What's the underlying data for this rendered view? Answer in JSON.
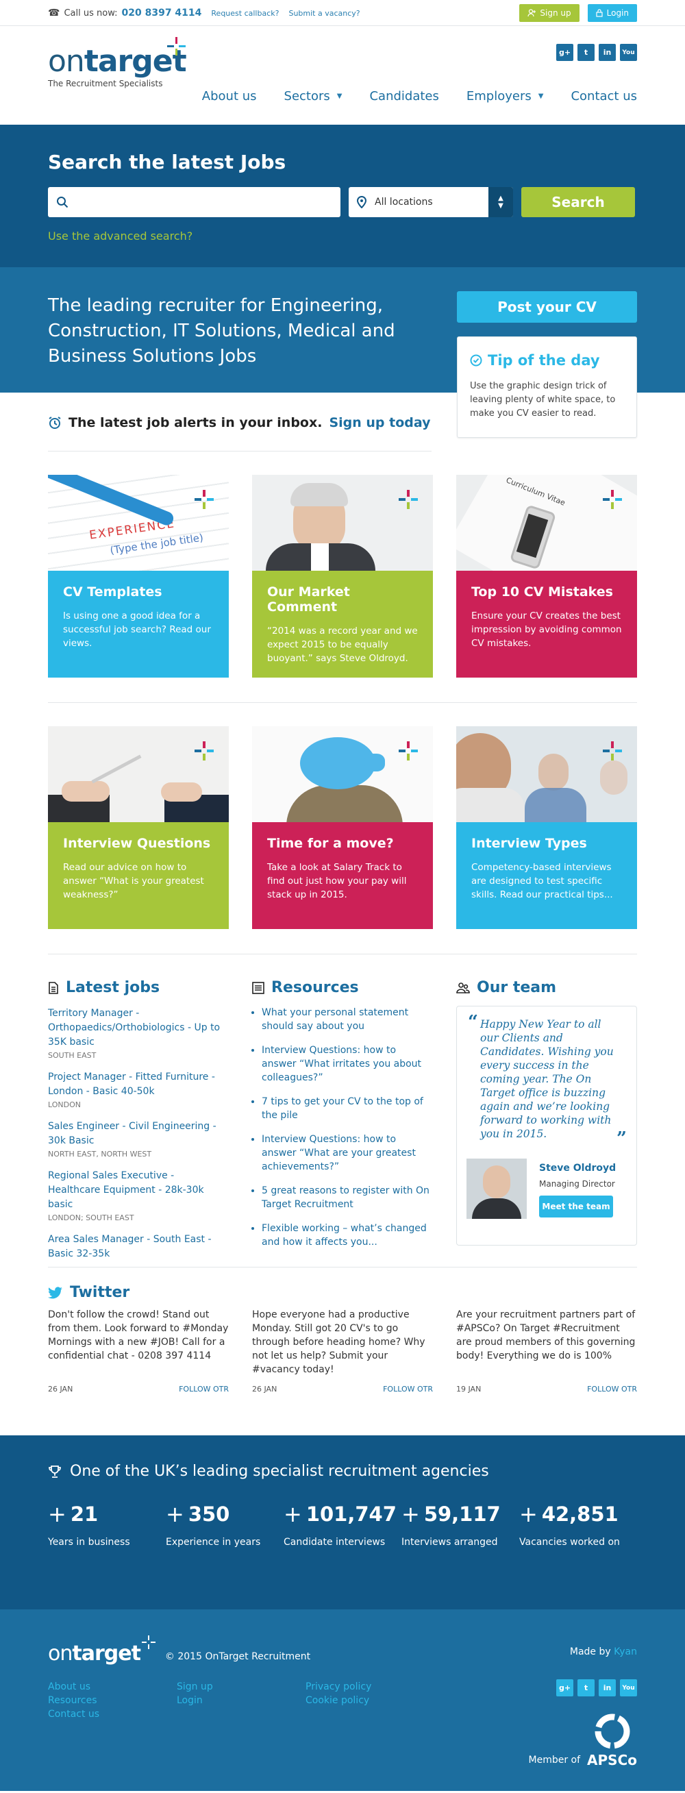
{
  "topbar": {
    "call_label": "Call us now:",
    "phone": "020 8397 4114",
    "callback": "Request callback?",
    "vacancy": "Submit a vacancy?",
    "signup": "Sign up",
    "login": "Login"
  },
  "logo": {
    "on": "on",
    "target": "target",
    "tagline": "The Recruitment Specialists"
  },
  "social": [
    "g+",
    "t",
    "in",
    "You"
  ],
  "nav": {
    "about": "About us",
    "sectors": "Sectors",
    "candidates": "Candidates",
    "employers": "Employers",
    "contact": "Contact us"
  },
  "search": {
    "title": "Search the latest Jobs",
    "keyword_placeholder": "",
    "location": "All locations",
    "button": "Search",
    "advanced": "Use the advanced search?"
  },
  "banner": {
    "headline": "The leading recruiter for Engineering, Construction, IT Solutions, Medical and Business Solutions Jobs",
    "post_cv": "Post your CV"
  },
  "tip": {
    "title": "Tip of the day",
    "text": "Use the graphic design trick of leaving plenty of white space, to make you CV easier to read."
  },
  "alerts": {
    "text": "The latest job alerts in your inbox.",
    "link": "Sign up today"
  },
  "cards": [
    {
      "title": "CV Templates",
      "text": "Is using one a good idea for a successful job search? Read our views."
    },
    {
      "title": "Our Market Comment",
      "text": "“2014 was a record year and we expect 2015 to be equally buoyant.” says Steve Oldroyd."
    },
    {
      "title": "Top 10 CV Mistakes",
      "text": "Ensure your CV creates the best impression by avoiding common CV mistakes."
    },
    {
      "title": "Interview Questions",
      "text": "Read our advice on how to answer “What is your greatest weakness?”"
    },
    {
      "title": "Time for a move?",
      "text": "Take a look at Salary Track to find out just how your pay will stack up in 2015."
    },
    {
      "title": "Interview Types",
      "text": "Competency-based interviews are designed to test specific skills. Read our practical tips..."
    }
  ],
  "card_images": {
    "cv_doc": "Curriculum Vitae",
    "experience": "EXPERIENCE",
    "paper_lines": "(Type the job title)"
  },
  "latest_jobs": {
    "title": "Latest jobs",
    "items": [
      {
        "title": "Territory Manager - Orthopaedics/Orthobiologics - Up to 35K basic",
        "loc": "SOUTH EAST"
      },
      {
        "title": "Project Manager - Fitted Furniture - London - Basic 40-50k",
        "loc": "LONDON"
      },
      {
        "title": "Sales Engineer - Civil Engineering - 30k Basic",
        "loc": "NORTH EAST, NORTH WEST"
      },
      {
        "title": "Regional Sales Executive - Healthcare Equipment - 28k-30k basic",
        "loc": "LONDON; SOUTH EAST"
      },
      {
        "title": "Area Sales Manager - South East - Basic 32-35k",
        "loc": ""
      }
    ]
  },
  "resources": {
    "title": "Resources",
    "items": [
      "What your personal statement should say about you",
      "Interview Questions: how to answer “What irritates you about colleagues?”",
      "7 tips to get your CV to the top of the pile",
      "Interview Questions: how to answer “What are your greatest achievements?”",
      "5 great reasons to register with On Target Recruitment",
      "Flexible working – what’s changed and how it affects you..."
    ]
  },
  "team": {
    "title": "Our team",
    "quote": "Happy New Year to all our Clients and Candidates. Wishing you every success in the coming year. The On Target office is buzzing again and we’re looking forward to working with you in 2015.",
    "name": "Steve Oldroyd",
    "role": "Managing Director",
    "button": "Meet the team"
  },
  "twitter": {
    "title": "Twitter",
    "tweets": [
      {
        "text": "Don't follow the crowd! Stand out from them. Look forward to #Monday Mornings with a new #JOB! Call for a confidential chat - 0208 397 4114",
        "date": "26 JAN",
        "follow": "FOLLOW OTR"
      },
      {
        "text": "Hope everyone had a productive Monday. Still got 20 CV's to go through before heading home? Why not let us help? Submit your #vacancy today!",
        "date": "26 JAN",
        "follow": "FOLLOW OTR"
      },
      {
        "text": "Are your recruitment partners part of #APSCo? On Target #Recruitment are proud members of this governing body! Everything we do is 100%",
        "date": "19 JAN",
        "follow": "FOLLOW OTR"
      }
    ]
  },
  "stats": {
    "title": "One of the UK’s leading specialist recruitment agencies",
    "items": [
      {
        "value": "21",
        "label": "Years in business"
      },
      {
        "value": "350",
        "label": "Experience in years"
      },
      {
        "value": "101,747",
        "label": "Candidate interviews"
      },
      {
        "value": "59,117",
        "label": "Interviews arranged"
      },
      {
        "value": "42,851",
        "label": "Vacancies worked on"
      }
    ]
  },
  "footer": {
    "copyright": "© 2015 OnTarget Recruitment",
    "made_by": "Made by",
    "made_by_link": "Kyan",
    "col1": [
      "About us",
      "Resources",
      "Contact us"
    ],
    "col2": [
      "Sign up",
      "Login"
    ],
    "col3": [
      "Privacy policy",
      "Cookie policy"
    ],
    "member_of": "Member of",
    "apsco": "APSCo"
  },
  "colors": {
    "navy": "#115786",
    "blue": "#1c6e9f",
    "cyan": "#2bb8e6",
    "lime": "#a6c63a",
    "rose": "#cc2157"
  }
}
